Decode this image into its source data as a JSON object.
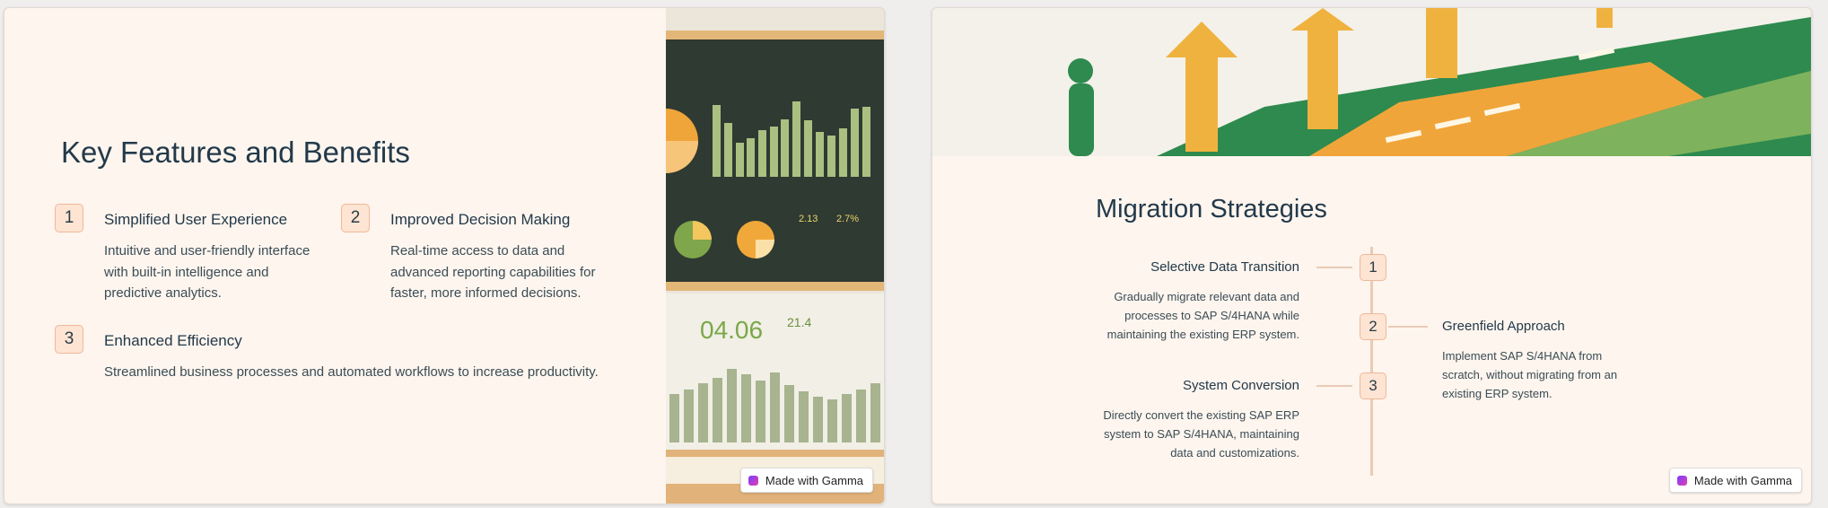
{
  "slide1": {
    "title": "Key Features and Benefits",
    "features": [
      {
        "number": "1",
        "title": "Simplified User Experience",
        "desc": [
          "Intuitive and user-friendly interface",
          "with built-in intelligence and",
          "predictive analytics."
        ]
      },
      {
        "number": "2",
        "title": "Improved Decision Making",
        "desc": [
          "Real-time access to data and",
          "advanced reporting capabilities for",
          "faster, more informed decisions."
        ]
      },
      {
        "number": "3",
        "title": "Enhanced Efficiency",
        "desc": [
          "Streamlined business processes and automated workflows to increase productivity."
        ]
      }
    ],
    "badge_label": "Made with Gamma",
    "image_icon": "dashboard-illustration"
  },
  "slide2": {
    "title": "Migration Strategies",
    "strategies": [
      {
        "number": "1",
        "title": "Selective Data Transition",
        "desc": [
          "Gradually migrate relevant data and",
          "processes to SAP S/4HANA while",
          "maintaining the existing ERP system."
        ]
      },
      {
        "number": "2",
        "title": "Greenfield Approach",
        "desc": [
          "Implement SAP S/4HANA from",
          "scratch, without migrating from an",
          "existing ERP system."
        ]
      },
      {
        "number": "3",
        "title": "System Conversion",
        "desc": [
          "Directly convert the existing SAP ERP",
          "system to SAP S/4HANA, maintaining",
          "data and customizations."
        ]
      }
    ],
    "badge_label": "Made with Gamma",
    "image_icon": "people-arrows-illustration"
  },
  "colors": {
    "accent": "#fde4d3",
    "accent_border": "#f0b89a",
    "timeline": "#e9cbb6",
    "card_bg": "#fdf5ee",
    "heading": "#23394a"
  }
}
